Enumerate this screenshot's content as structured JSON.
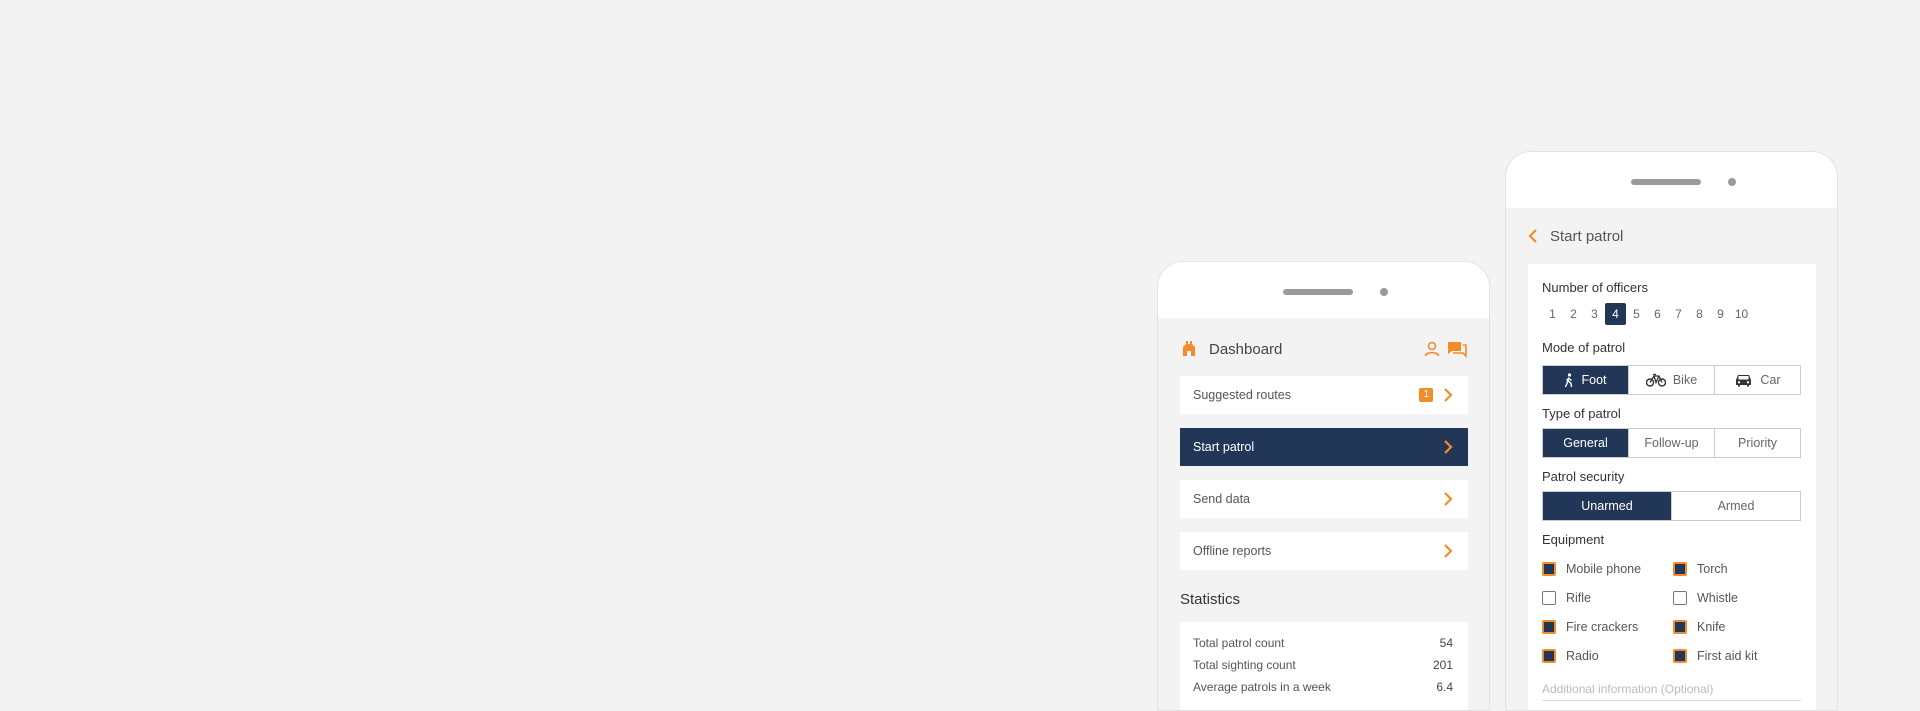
{
  "dashboard": {
    "title": "Dashboard",
    "menu": [
      {
        "label": "Suggested routes",
        "badge": "1"
      },
      {
        "label": "Start patrol"
      },
      {
        "label": "Send data"
      },
      {
        "label": "Offline reports"
      }
    ],
    "statistics_title": "Statistics",
    "stats": [
      {
        "label": "Total patrol count",
        "value": "54"
      },
      {
        "label": "Total sighting count",
        "value": "201"
      },
      {
        "label": "Average patrols in a week",
        "value": "6.4"
      }
    ]
  },
  "start_patrol": {
    "title": "Start patrol",
    "officers_label": "Number of officers",
    "officers": [
      "1",
      "2",
      "3",
      "4",
      "5",
      "6",
      "7",
      "8",
      "9",
      "10"
    ],
    "officers_selected": "4",
    "mode_label": "Mode of patrol",
    "modes": [
      "Foot",
      "Bike",
      "Car"
    ],
    "mode_selected": "Foot",
    "type_label": "Type of patrol",
    "types": [
      "General",
      "Follow-up",
      "Priority"
    ],
    "type_selected": "General",
    "security_label": "Patrol security",
    "security": [
      "Unarmed",
      "Armed"
    ],
    "security_selected": "Unarmed",
    "equipment_label": "Equipment",
    "equipment": [
      {
        "label": "Mobile phone",
        "checked": true
      },
      {
        "label": "Torch",
        "checked": true
      },
      {
        "label": "Rifle",
        "checked": false
      },
      {
        "label": "Whistle",
        "checked": false
      },
      {
        "label": "Fire crackers",
        "checked": true
      },
      {
        "label": "Knife",
        "checked": true
      },
      {
        "label": "Radio",
        "checked": true
      },
      {
        "label": "First aid kit",
        "checked": true
      }
    ],
    "additional_placeholder": "Additional information (Optional)"
  },
  "colors": {
    "accent": "#f28c28",
    "primary": "#223758",
    "background": "#f3f3f3"
  }
}
